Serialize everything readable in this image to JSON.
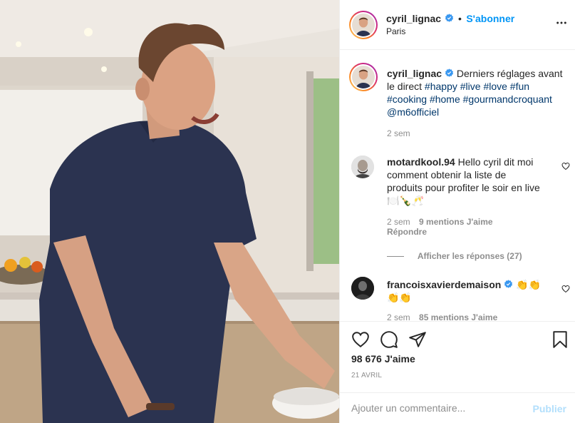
{
  "post": {
    "author": "cyril_lignac",
    "follow_label": "S'abonner",
    "follow_separator": "•",
    "location": "Paris",
    "caption_lines": [
      {
        "intro": "Derniers réglages avant"
      },
      {
        "rest": "le direct "
      },
      {
        "tags_line_3": "#cooking #home #gourmandcroquant"
      },
      {
        "mention": "@m6officiel"
      }
    ],
    "caption_text": "Derniers réglages avant",
    "caption_line2_prefix": "le direct",
    "caption_tags_2": [
      "#happy",
      "#live",
      "#love",
      "#fun"
    ],
    "caption_tags_3": [
      "#cooking",
      "#home",
      "#gourmandcroquant"
    ],
    "caption_mention": "@m6officiel",
    "caption_age": "2 sem"
  },
  "comments": [
    {
      "user": "motardkool.94",
      "lines": [
        "Hello cyril dit moi",
        "comment obtenir la liste de",
        "produits pour profiter le soir en live"
      ],
      "emoji": "🍽️🍾🥂",
      "age": "2 sem",
      "likes": "9 mentions J'aime",
      "reply": "Répondre",
      "view_replies": "Afficher les réponses (27)"
    },
    {
      "user": "francoisxavierdemaison",
      "emoji_line1": "👏👏",
      "emoji_line2": "👏👏",
      "age": "2 sem",
      "likes": "85 mentions J'aime"
    }
  ],
  "actions": {
    "like_icon": "heart-icon",
    "comment_icon": "comment-icon",
    "share_icon": "send-icon",
    "save_icon": "bookmark-icon",
    "likes_count": "98 676 J'aime",
    "date": "21 AVRIL"
  },
  "comment_box": {
    "placeholder": "Ajouter un commentaire...",
    "publish_label": "Publier"
  },
  "colors": {
    "accent": "#0095f6",
    "hashtag": "#00376b",
    "muted": "#8e8e8e",
    "publish_disabled": "#b2dffc"
  }
}
